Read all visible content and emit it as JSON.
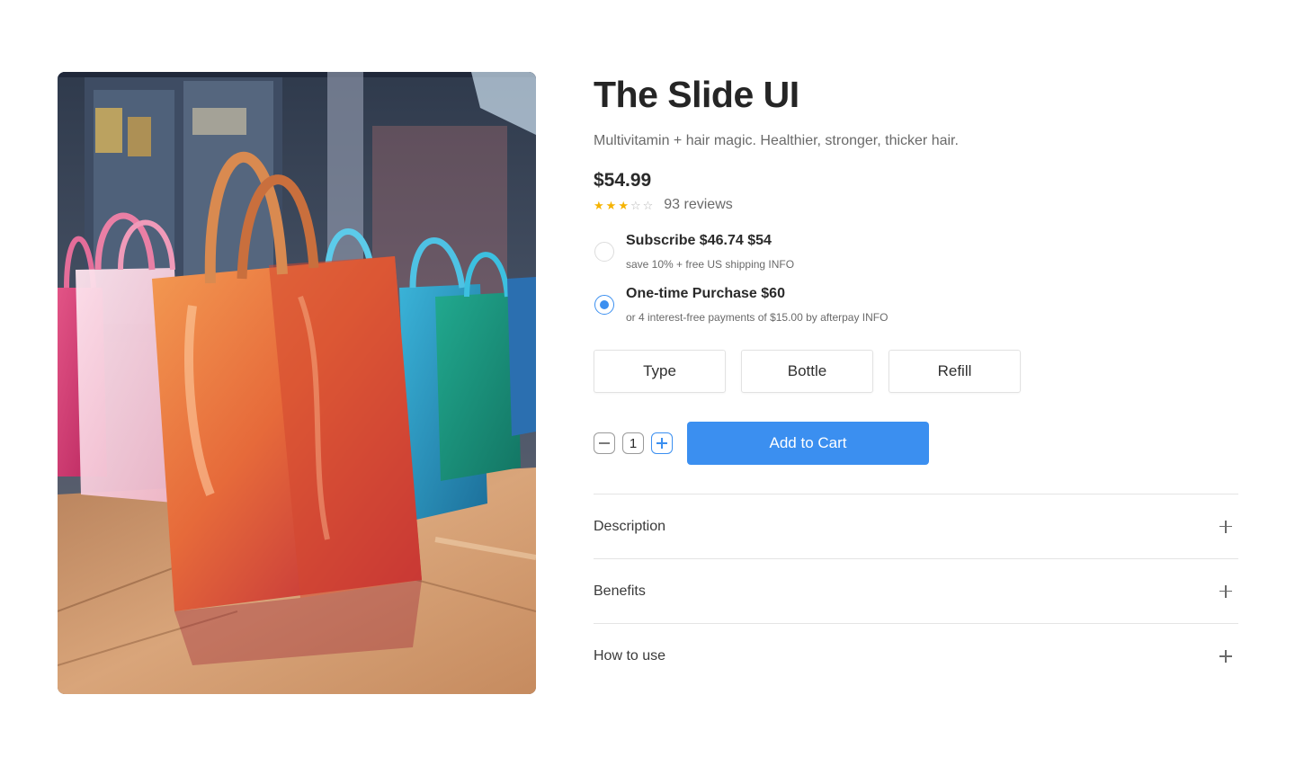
{
  "product": {
    "title": "The Slide UI",
    "subtitle": "Multivitamin + hair magic. Healthier, stronger, thicker hair.",
    "price": "$54.99",
    "rating": 3,
    "rating_max": 5,
    "reviews": "93 reviews",
    "image": {
      "alt": "Glossy colorful shopping bags on a wooden floor in a shop",
      "subject": "shopping-bags-photo"
    }
  },
  "purchase_options": [
    {
      "title": "Subscribe $46.74 $54",
      "subtitle": "save 10% + free US shipping INFO",
      "selected": false
    },
    {
      "title": "One-time Purchase $60",
      "subtitle": "or 4 interest-free payments of $15.00 by afterpay INFO",
      "selected": true
    }
  ],
  "variants": [
    "Type",
    "Bottle",
    "Refill"
  ],
  "cart": {
    "quantity": "1",
    "add_label": "Add to Cart",
    "minus_icon": "minus-icon",
    "plus_icon": "plus-icon"
  },
  "accordion": [
    "Description",
    "Benefits",
    "How to use"
  ],
  "colors": {
    "accent": "#3b8ff0",
    "star": "#f5b301",
    "text": "#2b2b2b",
    "muted": "#6a6a6a",
    "border": "#e4e4e4"
  }
}
